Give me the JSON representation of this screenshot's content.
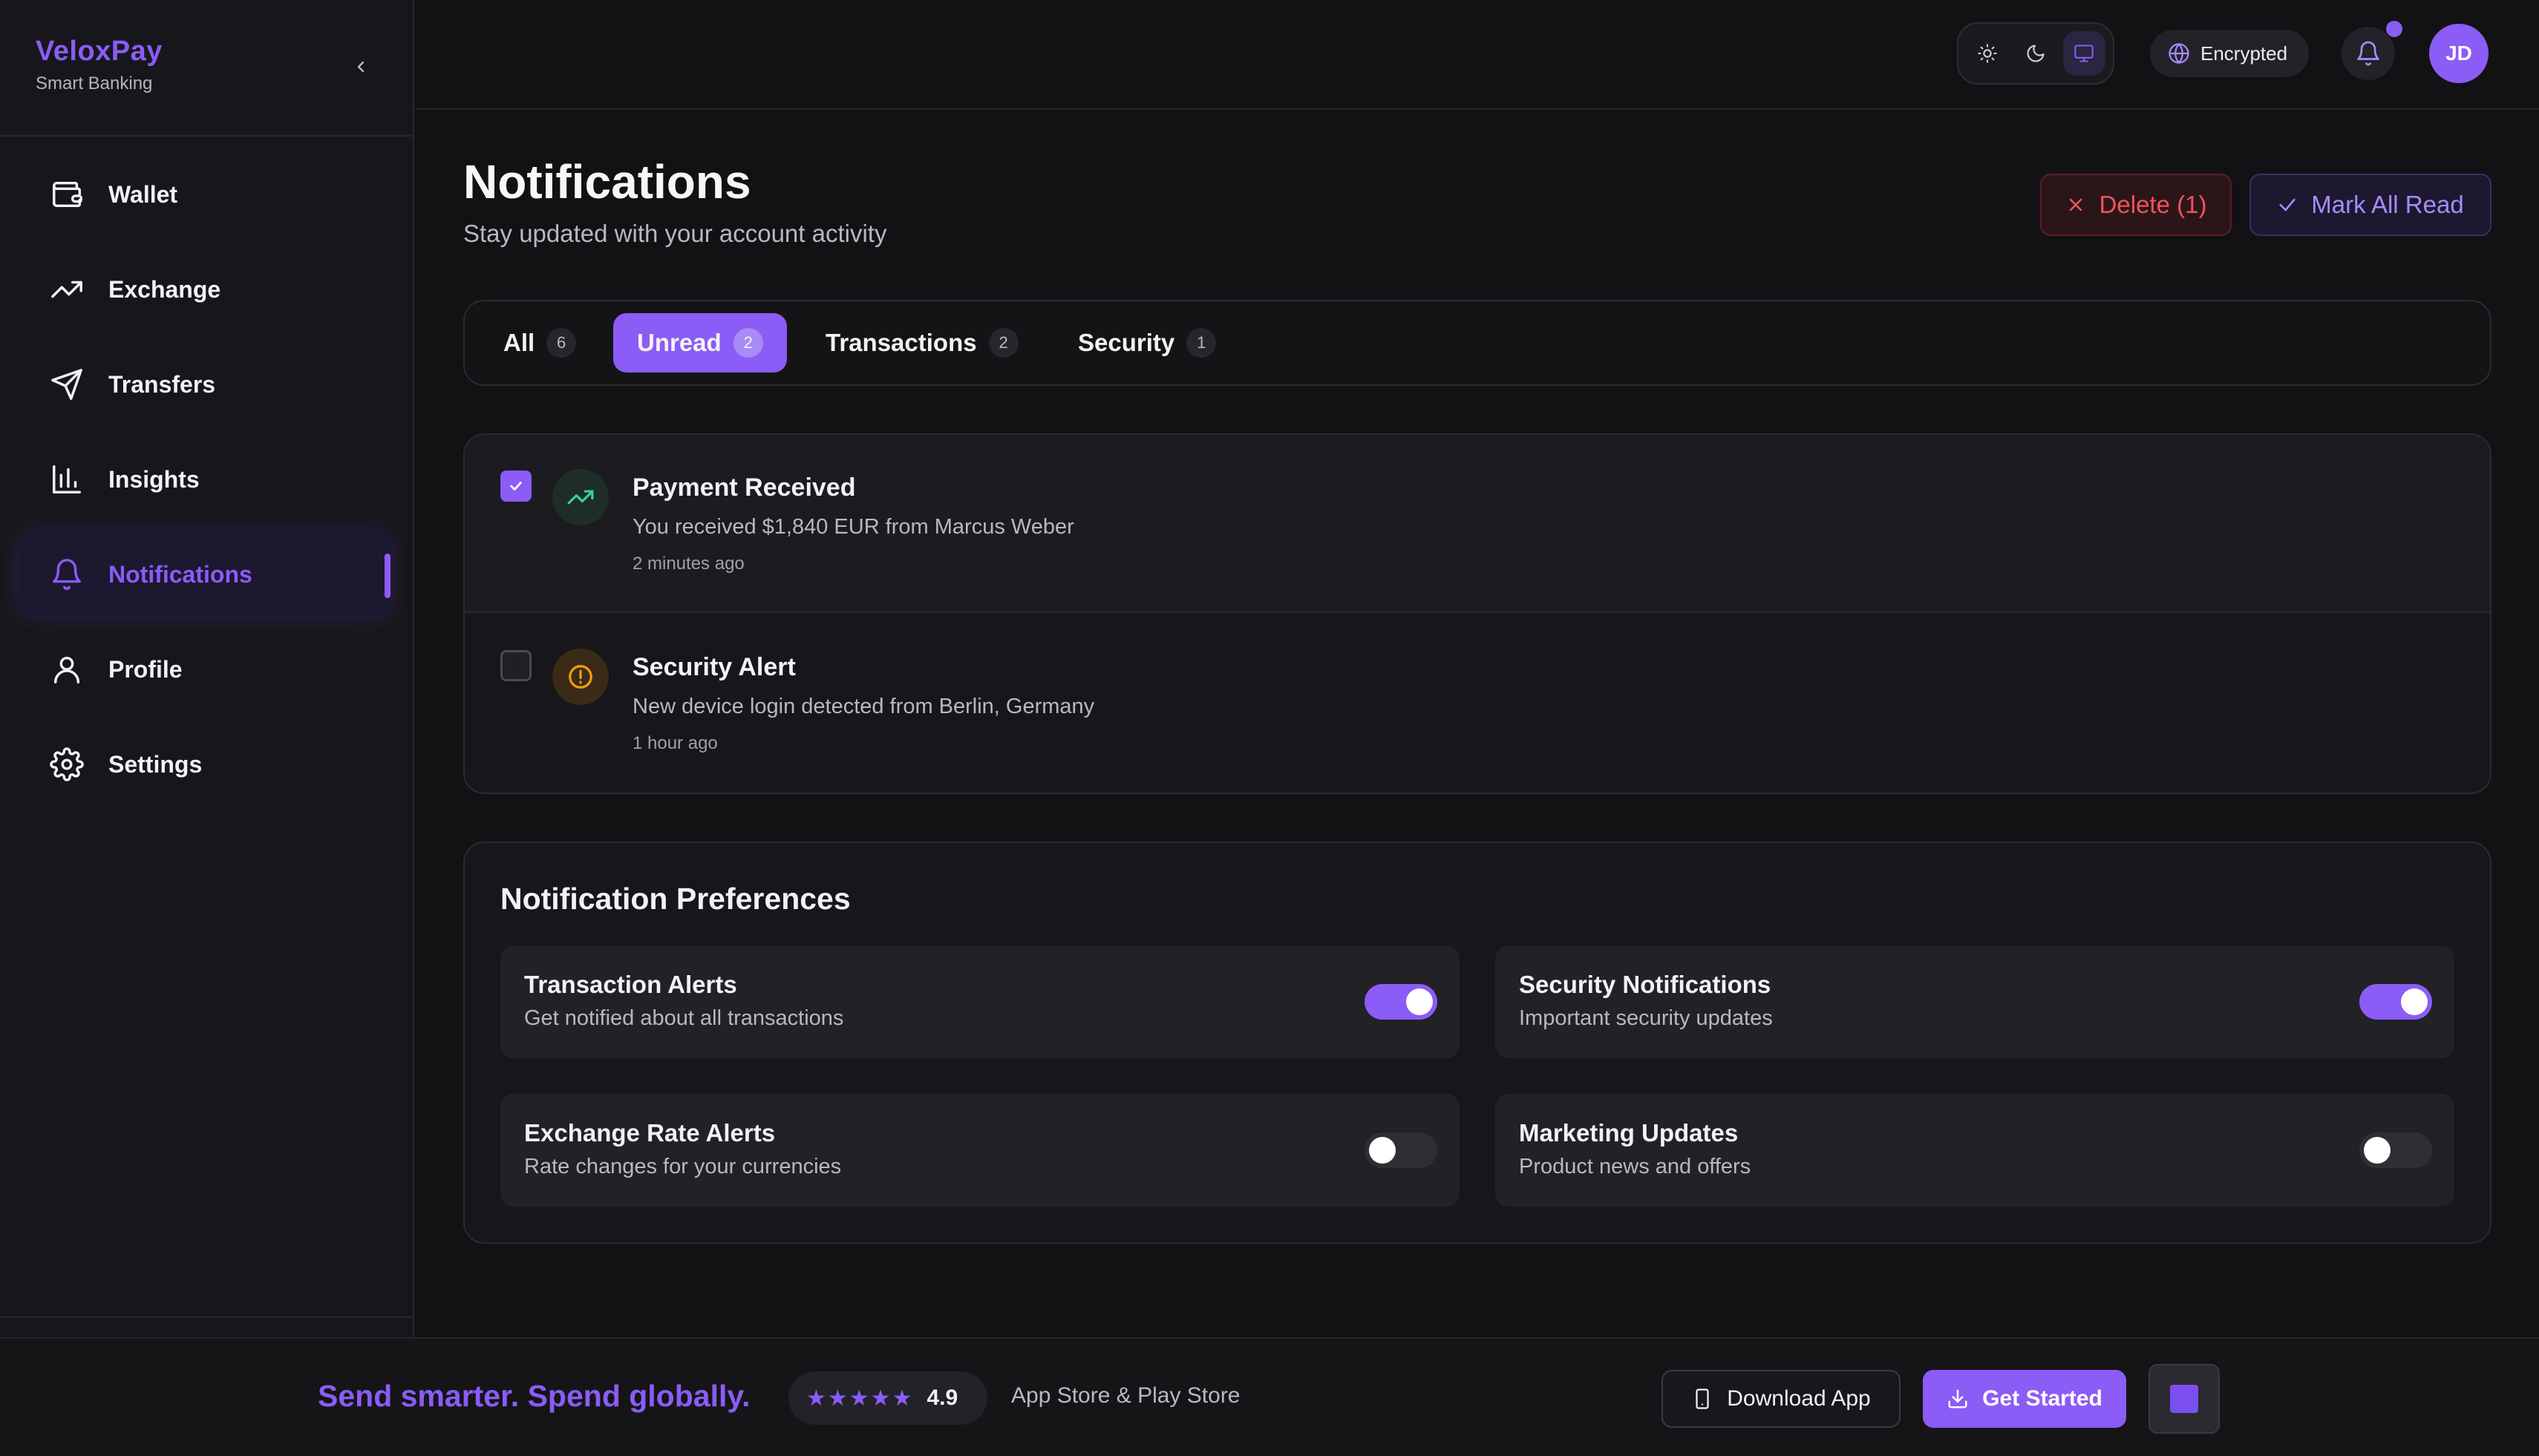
{
  "brand": {
    "name": "VeloxPay",
    "subtitle": "Smart Banking"
  },
  "sidebar": {
    "items": [
      {
        "label": "Wallet",
        "icon": "wallet-icon"
      },
      {
        "label": "Exchange",
        "icon": "trending-up-icon"
      },
      {
        "label": "Transfers",
        "icon": "send-icon"
      },
      {
        "label": "Insights",
        "icon": "bar-chart-icon"
      },
      {
        "label": "Notifications",
        "icon": "bell-icon",
        "active": true
      },
      {
        "label": "Profile",
        "icon": "user-icon"
      },
      {
        "label": "Settings",
        "icon": "gear-icon"
      }
    ]
  },
  "header": {
    "theme_options": [
      "sun-icon",
      "moon-icon",
      "monitor-icon"
    ],
    "theme_selected": "monitor-icon",
    "encrypted_label": "Encrypted",
    "avatar_initials": "JD"
  },
  "page": {
    "title": "Notifications",
    "subtitle": "Stay updated with your account activity",
    "delete_label": "Delete (1)",
    "mark_all_label": "Mark All Read"
  },
  "tabs": [
    {
      "label": "All",
      "count": "6"
    },
    {
      "label": "Unread",
      "count": "2",
      "active": true
    },
    {
      "label": "Transactions",
      "count": "2"
    },
    {
      "label": "Security",
      "count": "1"
    }
  ],
  "notifications": [
    {
      "title": "Payment Received",
      "message": "You received $1,840 EUR from Marcus Weber",
      "time": "2 minutes ago",
      "checked": true,
      "icon": "trending-up-icon",
      "unread": true
    },
    {
      "title": "Security Alert",
      "message": "New device login detected from Berlin, Germany",
      "time": "1 hour ago",
      "checked": false,
      "icon": "alert-circle-icon",
      "unread": true
    }
  ],
  "preferences": {
    "title": "Notification Preferences",
    "items": [
      {
        "name": "Transaction Alerts",
        "description": "Get notified about all transactions",
        "enabled": true
      },
      {
        "name": "Security Notifications",
        "description": "Important security updates",
        "enabled": true
      },
      {
        "name": "Exchange Rate Alerts",
        "description": "Rate changes for your currencies",
        "enabled": false
      },
      {
        "name": "Marketing Updates",
        "description": "Product news and offers",
        "enabled": false
      }
    ]
  },
  "footer": {
    "tagline": "Send smarter. Spend globally.",
    "stars": "★★★★★",
    "rating": "4.9",
    "stores": "App Store & Play Store",
    "download_label": "Download App",
    "get_started_label": "Get Started"
  },
  "colors": {
    "accent": "#8b5cf6",
    "danger": "#f0525d",
    "background": "#121214",
    "surface": "#17171b"
  }
}
